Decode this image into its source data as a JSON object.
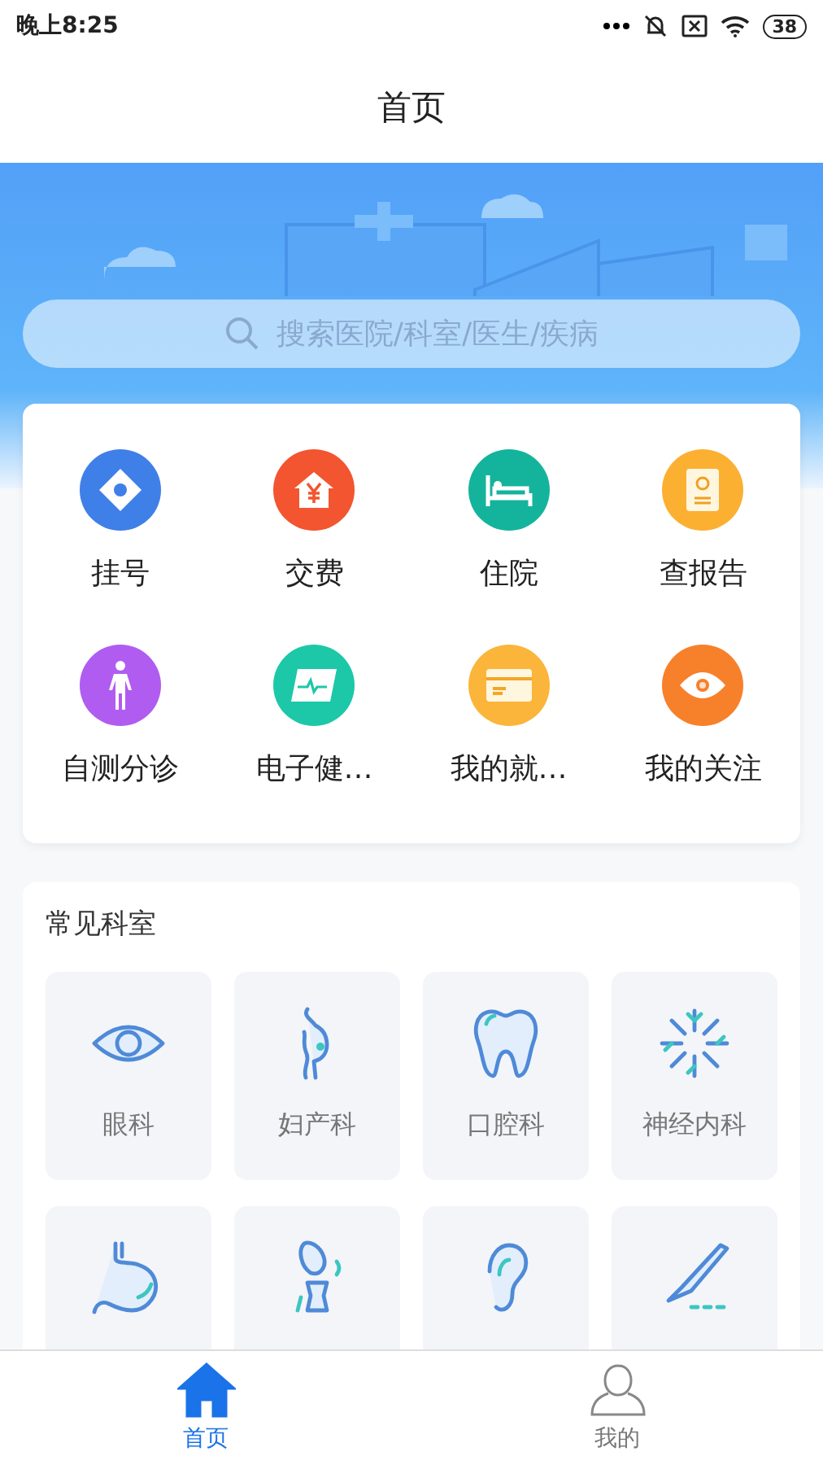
{
  "status_bar": {
    "time": "晚上8:25",
    "battery": "38"
  },
  "header": {
    "title": "首页"
  },
  "search": {
    "placeholder": "搜索医院/科室/医生/疾病"
  },
  "services": [
    {
      "label": "挂号",
      "kind": "register",
      "color": "#3f7fe8"
    },
    {
      "label": "交费",
      "kind": "pay",
      "color": "#f2552f"
    },
    {
      "label": "住院",
      "kind": "hospital",
      "color": "#14b49c"
    },
    {
      "label": "查报告",
      "kind": "report",
      "color": "#fbb032"
    },
    {
      "label": "自测分诊",
      "kind": "body",
      "color": "#b05cf0"
    },
    {
      "label": "电子健…",
      "kind": "health",
      "color": "#1cc8a8"
    },
    {
      "label": "我的就…",
      "kind": "card",
      "color": "#fbb53a"
    },
    {
      "label": "我的关注",
      "kind": "eye",
      "color": "#f7802a"
    }
  ],
  "departments": {
    "title": "常见科室",
    "items": [
      {
        "label": "眼科",
        "kind": "eye"
      },
      {
        "label": "妇产科",
        "kind": "pregnant"
      },
      {
        "label": "口腔科",
        "kind": "tooth"
      },
      {
        "label": "神经内科",
        "kind": "neuron"
      },
      {
        "kind": "stomach"
      },
      {
        "kind": "bone"
      },
      {
        "kind": "ear"
      },
      {
        "kind": "scalpel"
      }
    ]
  },
  "tab_bar": [
    {
      "label": "首页",
      "kind": "home",
      "selected": true
    },
    {
      "label": "我的",
      "kind": "user",
      "selected": false
    }
  ]
}
